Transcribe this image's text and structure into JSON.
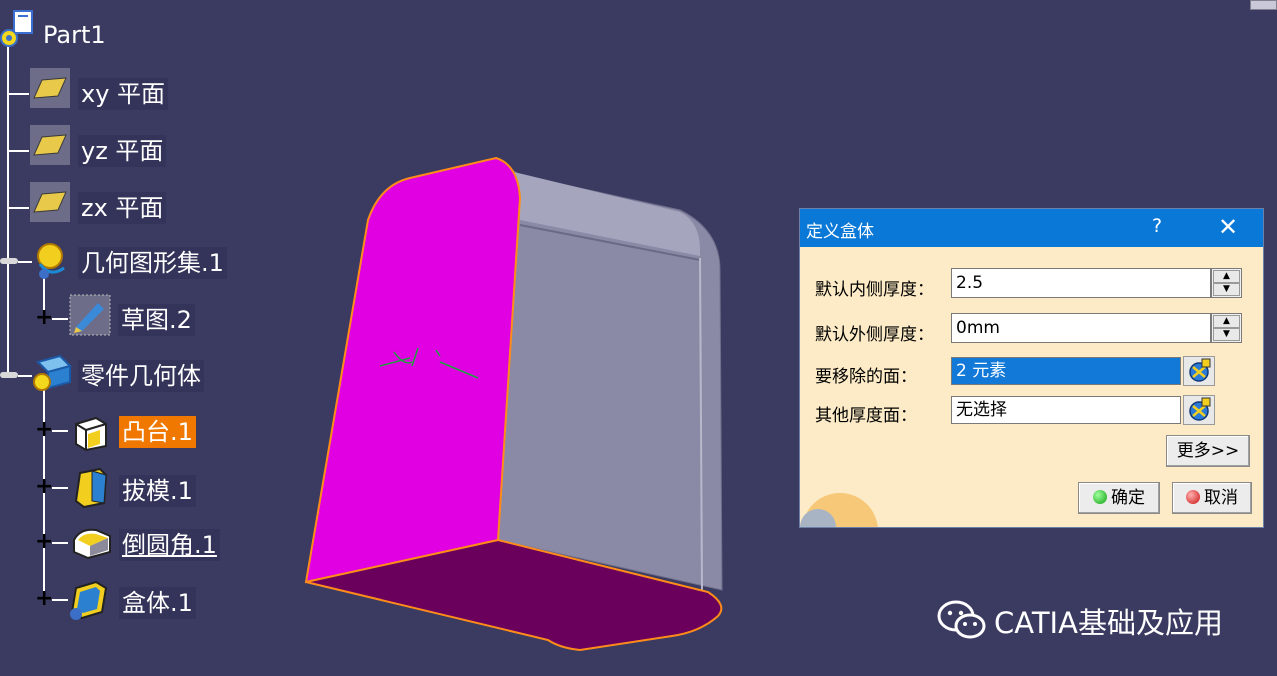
{
  "tree": {
    "root": "Part1",
    "items": [
      {
        "label": "xy 平面",
        "icon": "plane-icon"
      },
      {
        "label": "yz 平面",
        "icon": "plane-icon"
      },
      {
        "label": "zx 平面",
        "icon": "plane-icon"
      },
      {
        "label": "几何图形集.1",
        "icon": "geometric-set-icon"
      },
      {
        "label": "草图.2",
        "icon": "sketch-icon"
      },
      {
        "label": "零件几何体",
        "icon": "part-body-icon"
      },
      {
        "label": "凸台.1",
        "icon": "pad-icon"
      },
      {
        "label": "拔模.1",
        "icon": "draft-icon"
      },
      {
        "label": "倒圆角.1",
        "icon": "edge-fillet-icon"
      },
      {
        "label": "盒体.1",
        "icon": "shell-icon"
      }
    ]
  },
  "model": {
    "face_color": "#e100e1",
    "bottom_color": "#6a005c",
    "side_color": "#8a8aa6",
    "edge_color": "#ff8c1a"
  },
  "dialog": {
    "title": "定义盒体",
    "help": "?",
    "close": "✕",
    "inner_thickness_label": "默认内侧厚度：",
    "inner_thickness_value": "2.5",
    "outer_thickness_label": "默认外侧厚度：",
    "outer_thickness_value": "0mm",
    "faces_to_remove_label": "要移除的面：",
    "faces_to_remove_value": "2 元素",
    "other_thickness_label": "其他厚度面：",
    "other_thickness_value": "无选择",
    "more_button": "更多>>",
    "ok_button": "确定",
    "cancel_button": "取消",
    "spin_up": "▲",
    "spin_down": "▼"
  },
  "watermark": {
    "text": "CATIA基础及应用",
    "icon": "wechat-icon"
  },
  "colors": {
    "background": "#3b3b62",
    "active_node": "#f07800",
    "title_bar": "#0a78d7",
    "dialog_bg": "#fcebc6",
    "selection": "#1279d8"
  }
}
